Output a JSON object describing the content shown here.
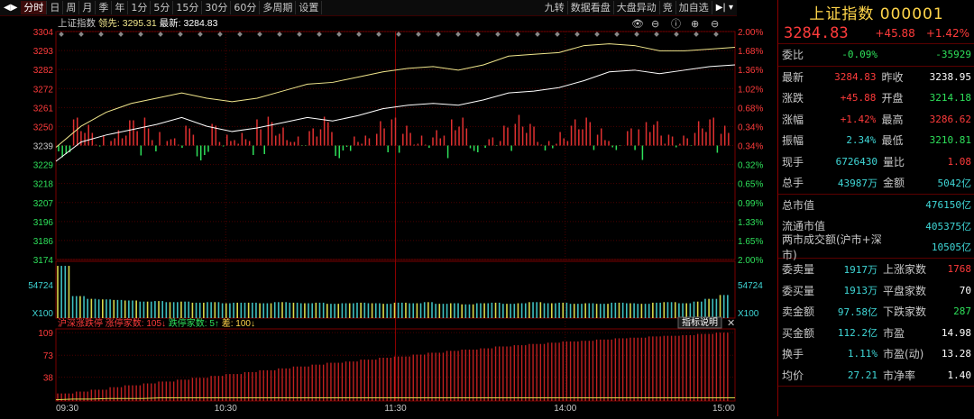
{
  "toolbar": {
    "items": [
      "分时",
      "日",
      "周",
      "月",
      "季",
      "年",
      "1分",
      "5分",
      "15分",
      "30分",
      "60分",
      "多周期",
      "设置"
    ],
    "right_items": [
      "九转",
      "数据看盘",
      "大盘异动",
      "竞",
      "加自选"
    ]
  },
  "chart_header": {
    "name": "上证指数",
    "lead_label": "领先:",
    "lead_value": "3295.31",
    "latest_label": "最新:",
    "latest_value": "3284.83"
  },
  "price_axis": {
    "left": [
      "3304",
      "3293",
      "3282",
      "3272",
      "3261",
      "3250",
      "3239",
      "3229",
      "3218",
      "3207",
      "3196",
      "3186",
      "3174"
    ],
    "right": [
      "2.00%",
      "1.68%",
      "1.36%",
      "1.02%",
      "0.68%",
      "0.34%",
      "0.34%",
      "0.32%",
      "0.65%",
      "0.99%",
      "1.33%",
      "1.65%",
      "2.00%"
    ],
    "right_colors": [
      "#ff3b3b",
      "#ff3b3b",
      "#ff3b3b",
      "#ff3b3b",
      "#ff3b3b",
      "#ff3b3b",
      "#ff3b3b",
      "#2ee05a",
      "#2ee05a",
      "#2ee05a",
      "#2ee05a",
      "#2ee05a",
      "#2ee05a"
    ]
  },
  "volume_axis": {
    "left_value": "54724",
    "right_value": "54724",
    "left_unit": "X100",
    "right_unit": "X100"
  },
  "indicator": {
    "title": "沪深涨跌停",
    "label1": "涨停家数:",
    "val1": "105",
    "label2": "跌停家数:",
    "val2": "5",
    "label3": "差:",
    "val3": "100",
    "button": "指标说明",
    "axis": [
      "109",
      "73",
      "38"
    ]
  },
  "time_axis": [
    "09:30",
    "10:30",
    "11:30",
    "14:00",
    "15:00"
  ],
  "chart_data": {
    "type": "line",
    "series": [
      {
        "name": "上证指数",
        "color": "#ffffff",
        "values": [
          3230,
          3241,
          3245,
          3248,
          3251,
          3255,
          3250,
          3247,
          3249,
          3252,
          3255,
          3253,
          3256,
          3260,
          3262,
          3263,
          3262,
          3265,
          3269,
          3270,
          3272,
          3276,
          3281,
          3282,
          3280,
          3282,
          3284,
          3285
        ]
      },
      {
        "name": "领先",
        "color": "#f0e68c",
        "values": [
          3238,
          3250,
          3258,
          3263,
          3266,
          3269,
          3266,
          3264,
          3266,
          3270,
          3274,
          3275,
          3278,
          3281,
          3283,
          3284,
          3282,
          3285,
          3290,
          3291,
          3292,
          3296,
          3297,
          3296,
          3293,
          3293,
          3294,
          3295
        ]
      }
    ],
    "ylim": [
      3174,
      3304
    ],
    "volume": [
      95,
      40,
      35,
      34,
      33,
      32,
      30,
      31,
      29,
      30,
      28,
      29,
      27,
      28,
      28,
      27,
      29,
      28,
      27,
      28,
      26,
      27,
      28,
      27,
      26,
      28,
      27,
      29,
      26,
      27,
      25,
      27,
      28,
      26,
      27,
      29,
      27,
      28,
      26,
      27,
      26,
      28,
      27,
      26,
      28,
      29,
      27,
      30,
      35,
      42
    ],
    "limit_up": [
      12,
      15,
      18,
      22,
      25,
      28,
      31,
      34,
      37,
      40,
      43,
      46,
      49,
      52,
      55,
      58,
      61,
      63,
      66,
      69,
      71,
      74,
      77,
      80,
      82,
      84,
      87,
      89,
      91,
      93,
      95,
      96,
      98,
      100,
      101,
      103,
      104,
      105,
      107,
      109
    ],
    "limit_down": [
      2,
      3,
      3,
      4,
      4,
      4,
      5,
      5,
      5,
      5,
      5,
      5,
      5,
      5,
      5,
      5,
      5,
      5,
      5,
      5,
      5,
      5,
      5,
      5,
      5,
      5,
      5,
      5,
      5,
      5,
      5,
      5,
      5,
      5,
      5,
      5,
      5,
      5,
      5,
      5
    ]
  },
  "side": {
    "title": "上证指数 000001",
    "price": "3284.83",
    "change": "+45.88",
    "pct": "+1.42%",
    "rows1": [
      {
        "lbl": "委比",
        "val": "-0.09%",
        "lbl2": "",
        "val2": "-35929"
      }
    ],
    "rows2": [
      {
        "lbl": "最新",
        "val": "3284.83",
        "lbl2": "昨收",
        "val2": "3238.95"
      },
      {
        "lbl": "涨跌",
        "val": "+45.88",
        "lbl2": "开盘",
        "val2": "3214.18"
      },
      {
        "lbl": "涨幅",
        "val": "+1.42%",
        "lbl2": "最高",
        "val2": "3286.62"
      },
      {
        "lbl": "振幅",
        "val": "2.34%",
        "lbl2": "最低",
        "val2": "3210.81"
      },
      {
        "lbl": "现手",
        "val": "6726430",
        "lbl2": "量比",
        "val2": "1.08"
      },
      {
        "lbl": "总手",
        "val": "43987万",
        "lbl2": "金额",
        "val2": "5042亿"
      }
    ],
    "rows3": [
      {
        "lbl": "总市值",
        "val2": "476150亿"
      },
      {
        "lbl": "流通市值",
        "val2": "405375亿"
      },
      {
        "lbl": "两市成交额(沪市+深市)",
        "val2": "10505亿"
      }
    ],
    "rows4": [
      {
        "lbl": "委卖量",
        "val": "1917万",
        "lbl2": "上涨家数",
        "val2": "1768"
      },
      {
        "lbl": "委买量",
        "val": "1913万",
        "lbl2": "平盘家数",
        "val2": "70"
      },
      {
        "lbl": "卖金额",
        "val": "97.58亿",
        "lbl2": "下跌家数",
        "val2": "287"
      },
      {
        "lbl": "买金额",
        "val": "112.2亿",
        "lbl2": "市盈",
        "val2": "14.98"
      },
      {
        "lbl": "换手",
        "val": "1.11%",
        "lbl2": "市盈(动)",
        "val2": "13.28"
      },
      {
        "lbl": "均价",
        "val": "27.21",
        "lbl2": "市净率",
        "val2": "1.40"
      }
    ]
  }
}
